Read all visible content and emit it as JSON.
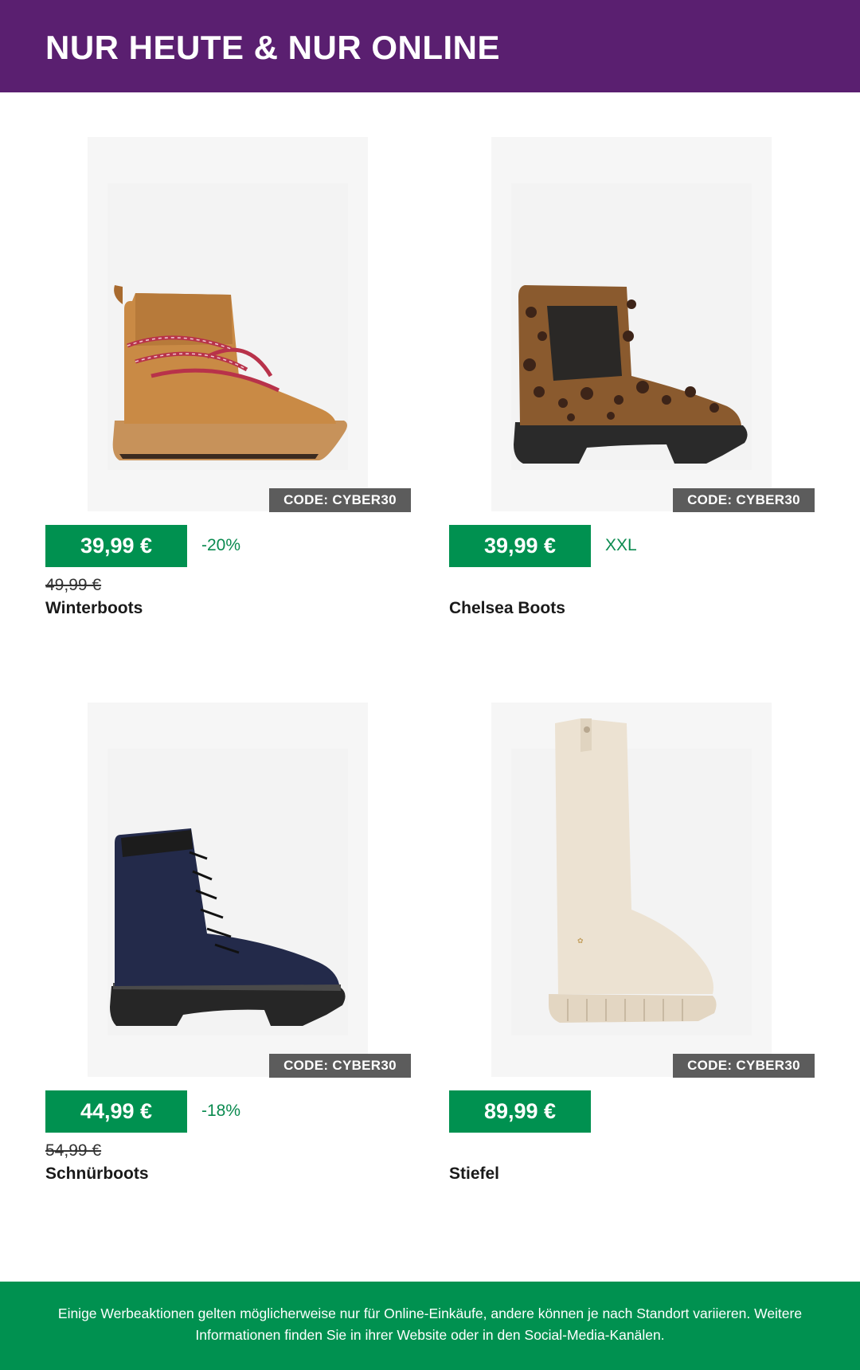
{
  "header": {
    "title": "NUR HEUTE & NUR ONLINE"
  },
  "colors": {
    "header_bg": "#5a1f70",
    "accent_green": "#009150",
    "badge_gray": "#5c5c5c"
  },
  "products": [
    {
      "name": "Winterboots",
      "price": "39,99 €",
      "tag": "-20%",
      "old_price": "49,99 €",
      "code": "CODE: CYBER30",
      "image": "brown-winter-boot-image"
    },
    {
      "name": "Chelsea Boots",
      "price": "39,99 €",
      "tag": "XXL",
      "old_price": "",
      "code": "CODE: CYBER30",
      "image": "leopard-chelsea-boot-image"
    },
    {
      "name": "Schnürboots",
      "price": "44,99 €",
      "tag": "-18%",
      "old_price": "54,99 €",
      "code": "CODE: CYBER30",
      "image": "navy-lace-up-boot-image"
    },
    {
      "name": "Stiefel",
      "price": "89,99 €",
      "tag": "",
      "old_price": "",
      "code": "CODE: CYBER30",
      "image": "cream-tall-boot-image"
    }
  ],
  "footer": {
    "text": "Einige Werbeaktionen gelten möglicherweise nur für Online-Einkäufe, andere können je nach Standort variieren. Weitere Informationen finden Sie in ihrer Website oder in den Social-Media-Kanälen."
  }
}
